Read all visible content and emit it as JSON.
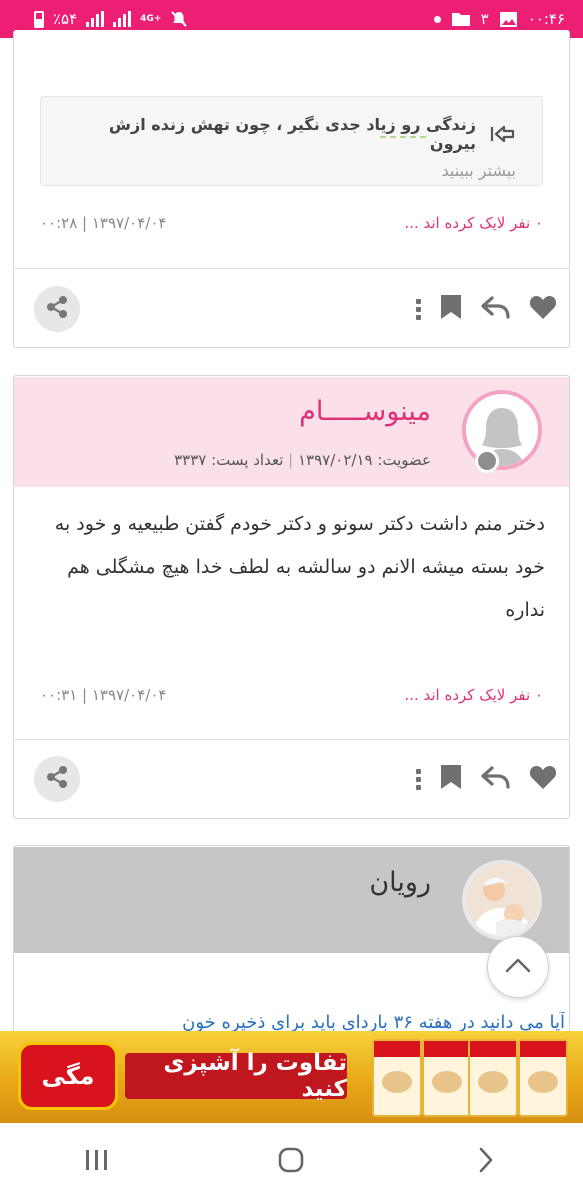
{
  "status_bar": {
    "time": "۰۰:۴۶",
    "notification_count": "۳",
    "battery": "٪۵۴",
    "network": "4G+",
    "background": "#ec1f74"
  },
  "accent_color": "#e03176",
  "post1": {
    "quote_text": "زندگی رو زیاد جدی نگیر ، چون تهش زنده ازش بیرون",
    "quote_more": "بیشتر ببینید",
    "likes": "۰ نفر لایک کرده اند ...",
    "date": "۰۰:۲۸ | ۱۳۹۷/۰۴/۰۴"
  },
  "post2": {
    "username": "مینوســـــام",
    "membership": "عضویت: ۱۳۹۷/۰۲/۱۹",
    "separator": "|",
    "post_count": "تعداد پست: ۳۳۳۷",
    "body": "دختر منم داشت دکتر سونو و دکتر خودم گفتن طبیعیه و خود به خود بسته میشه الانم دو سالشه به لطف خدا هیچ مشگلی هم نداره",
    "likes": "۰ نفر لایک کرده اند ...",
    "date": "۰۰:۳۱ | ۱۳۹۷/۰۴/۰۴"
  },
  "post3": {
    "username": "رویان",
    "partial_text": "آیا می دانید در هفته ۳۶ باردای باید برای ذخیره خون"
  },
  "ad": {
    "brand": "مگی",
    "slogan": "تفاوت را آشپزی کنید"
  },
  "icons": {
    "share": "share-icon",
    "menu": "more-vertical-icon",
    "bookmark": "bookmark-icon",
    "reply": "reply-icon",
    "like": "heart-icon",
    "scroll_top": "chevron-up-icon"
  }
}
